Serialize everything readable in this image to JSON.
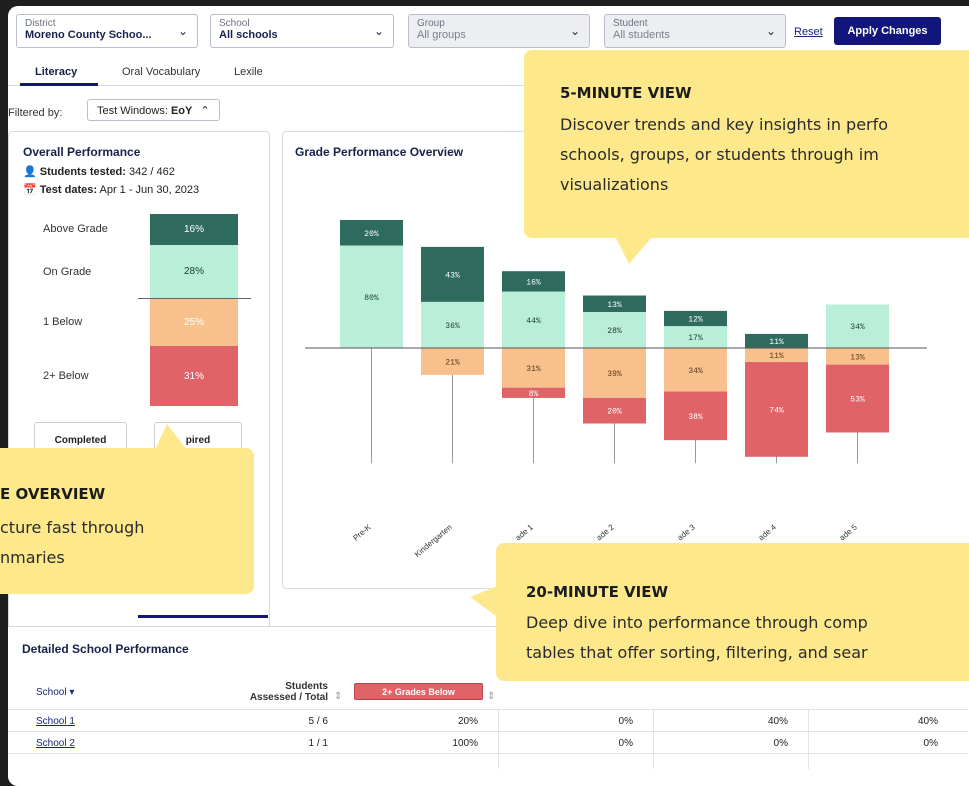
{
  "filters": {
    "district": {
      "label": "District",
      "value": "Moreno County Schoo..."
    },
    "school": {
      "label": "School",
      "value": "All schools"
    },
    "group": {
      "label": "Group",
      "value": "All groups"
    },
    "student": {
      "label": "Student",
      "value": "All students"
    },
    "reset_label": "Reset",
    "apply_label": "Apply Changes"
  },
  "tabs": [
    "Literacy",
    "Oral Vocabulary",
    "Lexile"
  ],
  "filtered_by": {
    "label": "Filtered by:",
    "chip_prefix": "Test Windows: ",
    "chip_value": "EoY",
    "chip_icon": "chevron-up-icon"
  },
  "overall": {
    "title": "Overall Performance",
    "students_tested_label": "Students tested:",
    "students_tested_value": "342 / 462",
    "test_dates_label": "Test dates:",
    "test_dates_value": "Apr 1 - Jun 30, 2023",
    "rows": [
      {
        "label": "Above Grade",
        "value": "16%",
        "color": "#2e6b5e"
      },
      {
        "label": "On Grade",
        "value": "28%",
        "color": "#b9efd9"
      },
      {
        "label": "1 Below",
        "value": "25%",
        "color": "#f7c08c"
      },
      {
        "label": "2+ Below",
        "value": "31%",
        "color": "#e06367"
      }
    ],
    "toggle_completed": "Completed",
    "toggle_expired": "pired"
  },
  "chart_data": {
    "type": "bar",
    "title": "Grade Performance Overview",
    "categories": [
      "Pre-K",
      "Kindergarten",
      "ade 1",
      "ade 2",
      "ade 3",
      "ade 4",
      "ade 5"
    ],
    "series": [
      {
        "name": "Above Grade",
        "color": "#2e6b5e",
        "values": [
          20,
          43,
          16,
          13,
          12,
          11,
          0
        ]
      },
      {
        "name": "On Grade",
        "color": "#b9efd9",
        "values": [
          80,
          36,
          44,
          28,
          17,
          0,
          34
        ]
      },
      {
        "name": "1 Below",
        "color": "#f7c08c",
        "values": [
          0,
          21,
          31,
          39,
          34,
          11,
          13
        ]
      },
      {
        "name": "2+ Below",
        "color": "#e06367",
        "values": [
          0,
          0,
          8,
          20,
          38,
          74,
          53
        ]
      }
    ]
  },
  "table": {
    "title": "Detailed School Performance",
    "col_school": "School",
    "col_students_line1": "Students",
    "col_students_line2": "Assessed / Total",
    "col_badge": "2+ Grades Below",
    "rows": [
      {
        "school": "School 1",
        "assessed": "5 / 6",
        "c1": "20%",
        "c2": "0%",
        "c3": "40%",
        "c4": "40%"
      },
      {
        "school": "School 2",
        "assessed": "1 / 1",
        "c1": "100%",
        "c2": "0%",
        "c3": "0%",
        "c4": "0%"
      }
    ]
  },
  "callouts": {
    "five": {
      "title": "5-MINUTE VIEW",
      "lines": [
        "Discover trends and key insights in perfo",
        "schools, groups, or students through im",
        "visualizations"
      ]
    },
    "one": {
      "title": "E OVERVIEW",
      "lines": [
        "cture fast through",
        "nmaries"
      ]
    },
    "twenty": {
      "title": "20-MINUTE VIEW",
      "lines": [
        "Deep dive into performance through comp",
        "tables that offer sorting, filtering, and sear"
      ]
    }
  }
}
